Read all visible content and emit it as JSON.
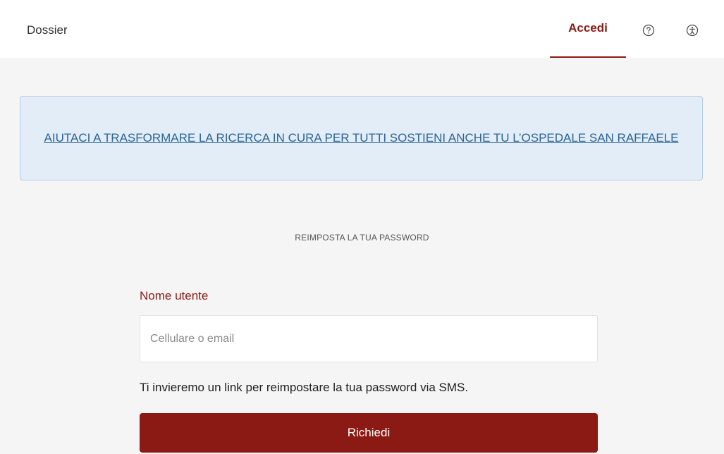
{
  "header": {
    "brand": "Dossier",
    "login_label": "Accedi",
    "icons": [
      "help-icon",
      "accessibility-icon"
    ]
  },
  "banner": {
    "link_text": "AIUTACI A TRASFORMARE LA RICERCA IN CURA PER TUTTI SOSTIENI ANCHE TU L’OSPEDALE SAN RAFFAELE"
  },
  "form": {
    "title": "REIMPOSTA LA TUA PASSWORD",
    "username_label": "Nome utente",
    "username_placeholder": "Cellulare o email",
    "username_value": "",
    "hint": "Ti invieremo un link per reimpostare la tua password via SMS.",
    "submit_label": "Richiedi"
  },
  "colors": {
    "accent": "#8b1a14",
    "banner_bg": "#e3edf7",
    "banner_link": "#2a6496",
    "page_bg": "#f5f5f5"
  }
}
